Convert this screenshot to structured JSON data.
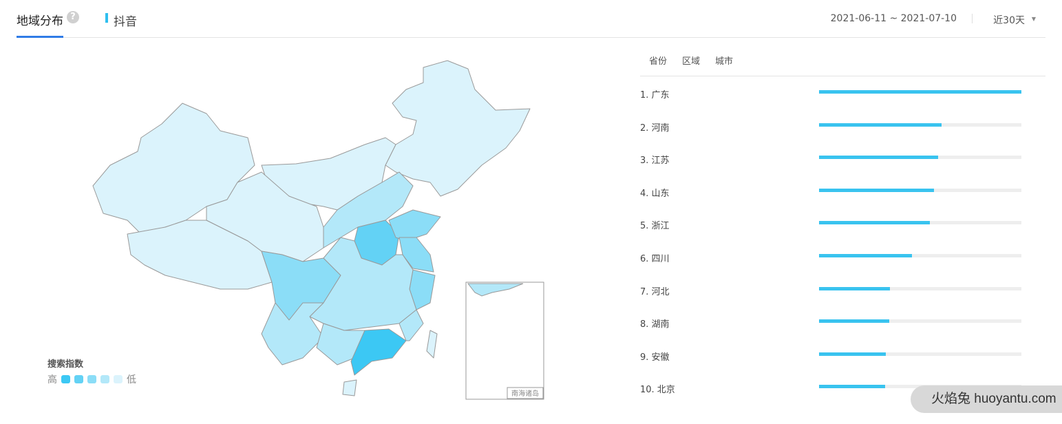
{
  "header": {
    "tab": "地域分布",
    "help_icon": "?",
    "platform": "抖音",
    "date_range": "2021-06-11 ~ 2021-07-10",
    "period": "近30天"
  },
  "legend": {
    "title": "搜索指数",
    "high": "高",
    "low": "低",
    "colors": [
      "#3cc8f4",
      "#63d2f5",
      "#8bddf7",
      "#b3e8f9",
      "#dbf3fc"
    ]
  },
  "map": {
    "inset_label": "南海诸岛"
  },
  "subtabs": [
    "省份",
    "区域",
    "城市"
  ],
  "ranking": [
    {
      "label": "1.  广东",
      "value": 100
    },
    {
      "label": "2.  河南",
      "value": 60.5
    },
    {
      "label": "3.  江苏",
      "value": 58.8
    },
    {
      "label": "4.  山东",
      "value": 56.8
    },
    {
      "label": "5.  浙江",
      "value": 54.8
    },
    {
      "label": "6.  四川",
      "value": 45.9
    },
    {
      "label": "7.  河北",
      "value": 35
    },
    {
      "label": "8.  湖南",
      "value": 34.7
    },
    {
      "label": "9.  安徽",
      "value": 33
    },
    {
      "label": "10. 北京",
      "value": 32.7
    }
  ],
  "watermark": "火焰兔 huoyantu.com"
}
